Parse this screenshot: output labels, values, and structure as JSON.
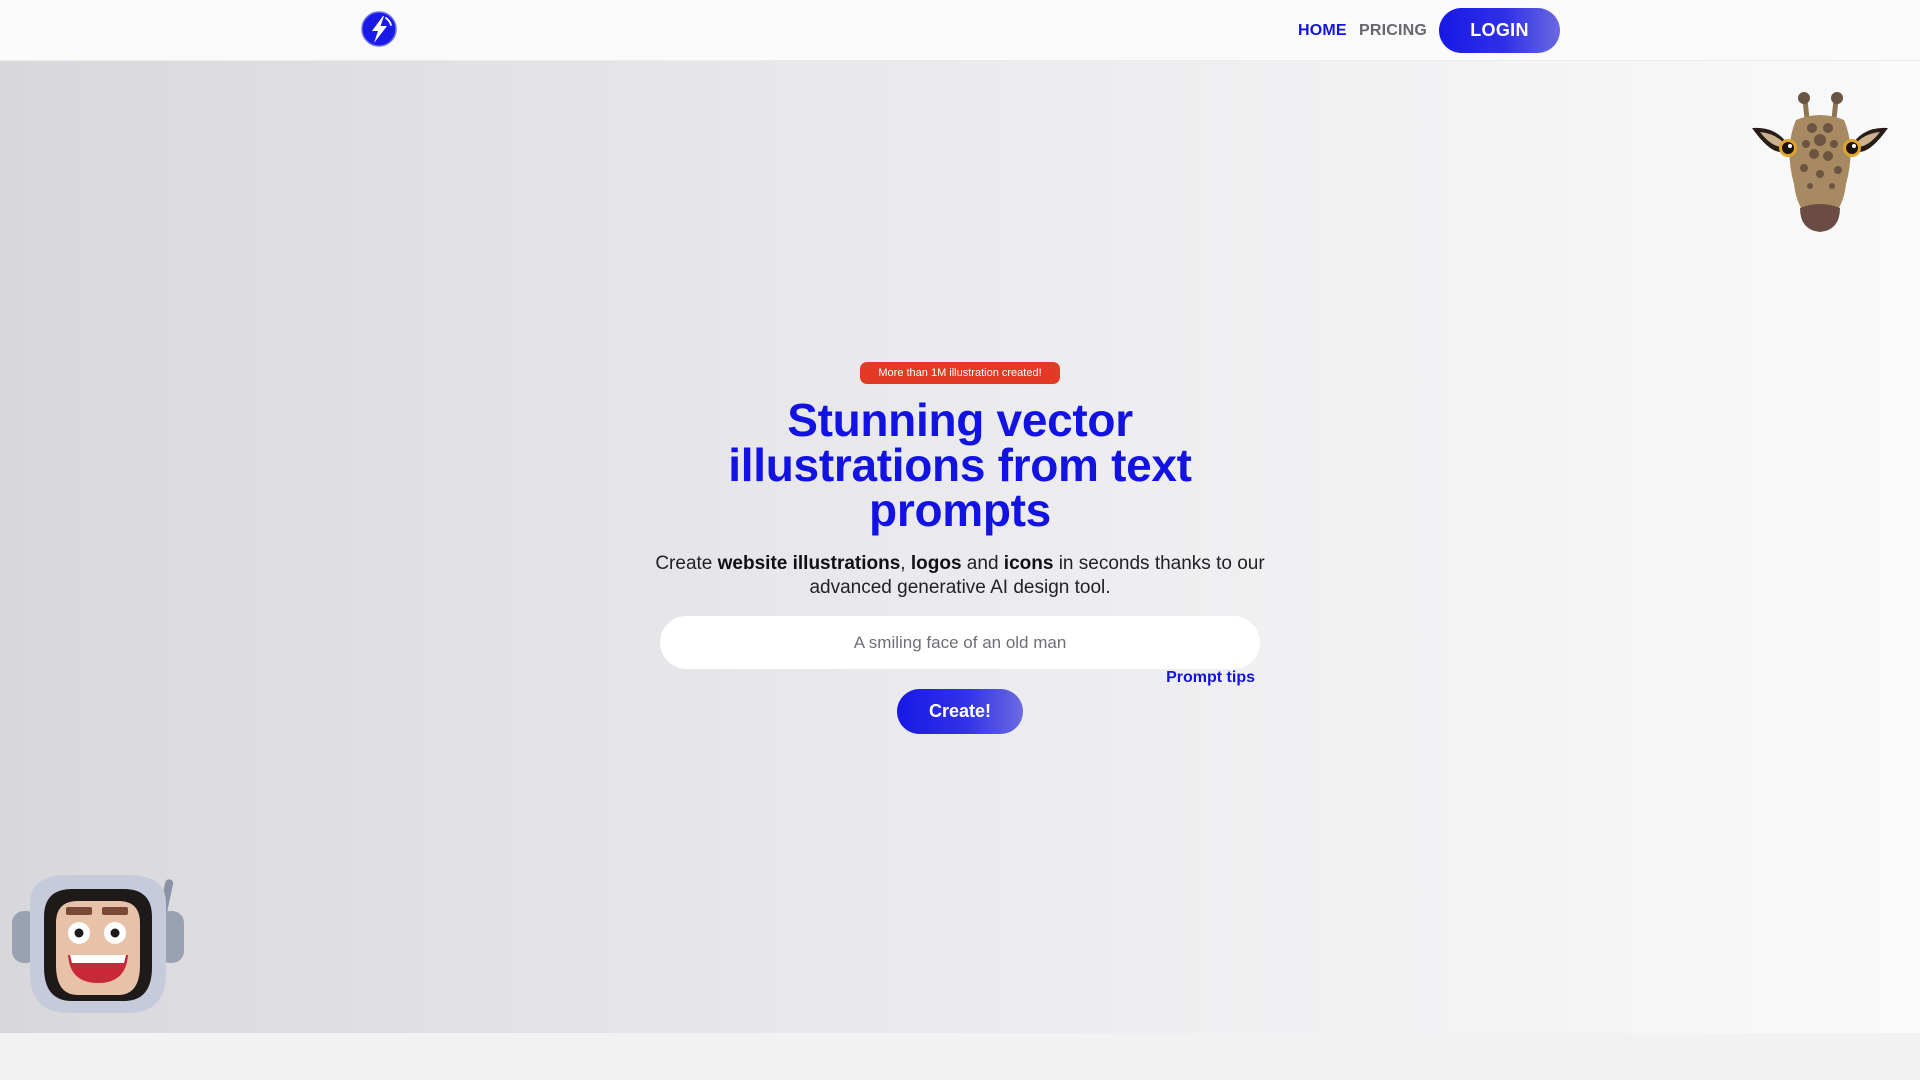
{
  "header": {
    "logo_icon": "lightning-bolt-logo-icon",
    "nav": {
      "home": "HOME",
      "pricing": "PRICING"
    },
    "login_label": "LOGIN"
  },
  "hero": {
    "badge": "More than 1M illustration created!",
    "headline": "Stunning vector illustrations from text prompts",
    "subhead": {
      "part1": "Create ",
      "bold1": "website illustrations",
      "part2": ", ",
      "bold2": "logos",
      "part3": " and ",
      "bold3": "icons",
      "part4": " in seconds thanks to our advanced generative AI design tool."
    },
    "prompt_placeholder": "A smiling face of an old man",
    "prompt_value": "",
    "prompt_tips": "Prompt tips",
    "create_label": "Create!"
  },
  "decorations": {
    "top_right": "giraffe-illustration",
    "bottom_left": "astronaut-illustration"
  },
  "colors": {
    "brand_blue": "#1212e2",
    "badge_red": "#e23a25",
    "gradient_end": "#6a6ae0"
  }
}
